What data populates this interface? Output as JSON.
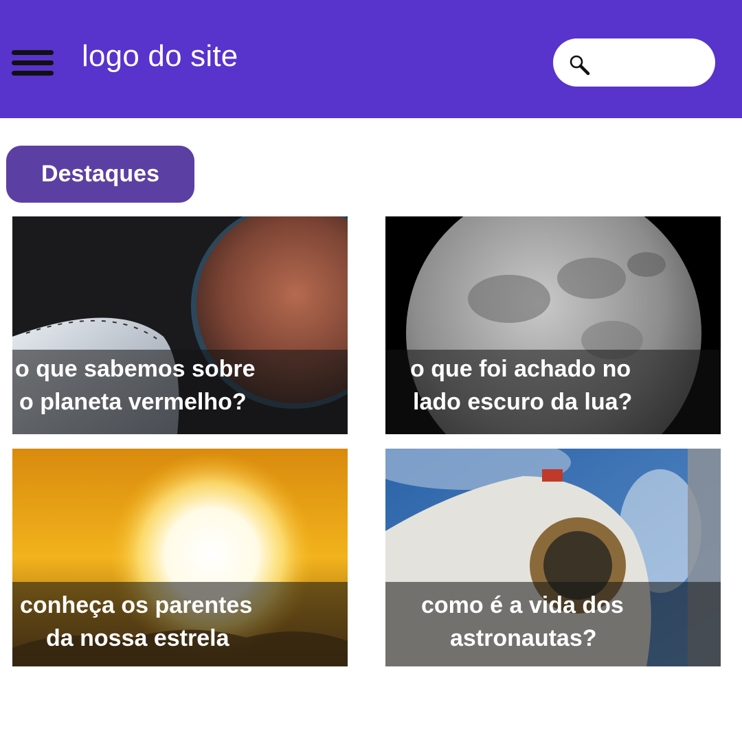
{
  "header": {
    "menu_icon": "hamburger-menu-icon",
    "logo_text": "logo do site",
    "search": {
      "icon": "search-icon",
      "placeholder": ""
    }
  },
  "section": {
    "label": "Destaques"
  },
  "cards": [
    {
      "image": "mars-spaceship-image",
      "caption_line1": "o que sabemos sobre",
      "caption_line2": "o planeta vermelho?"
    },
    {
      "image": "moon-image",
      "caption_line1": "o que foi achado no",
      "caption_line2": "lado escuro da lua?"
    },
    {
      "image": "sunset-sun-image",
      "caption_line1": "conheça os parentes",
      "caption_line2": "da nossa estrela"
    },
    {
      "image": "astronaut-image",
      "caption_line1": "como é a vida dos",
      "caption_line2": "astronautas?"
    }
  ],
  "colors": {
    "header": "#5833cc",
    "pill": "#5c3fa3"
  }
}
